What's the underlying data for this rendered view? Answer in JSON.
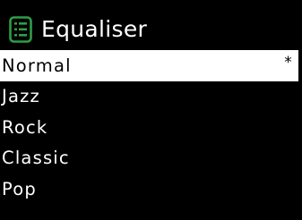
{
  "header": {
    "title": "Equaliser",
    "icon": "menu-list-icon"
  },
  "equaliser": {
    "items": [
      {
        "label": "Normal",
        "marker": "*",
        "selected": true
      },
      {
        "label": "Jazz",
        "marker": "",
        "selected": false
      },
      {
        "label": "Rock",
        "marker": "",
        "selected": false
      },
      {
        "label": "Classic",
        "marker": "",
        "selected": false
      },
      {
        "label": "Pop",
        "marker": "",
        "selected": false
      }
    ]
  },
  "colors": {
    "background": "#000000",
    "foreground": "#ffffff",
    "accent": "#2e9e45",
    "selection_background": "#ffffff",
    "selection_text": "#000000"
  }
}
